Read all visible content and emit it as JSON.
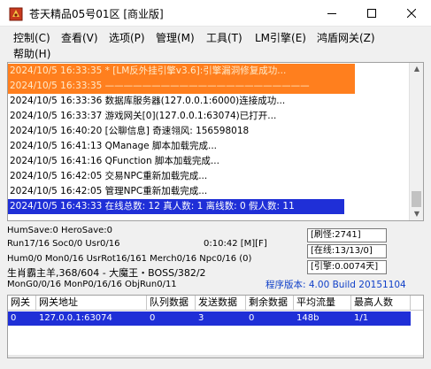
{
  "window": {
    "title": "苍天精品05号01区 [商业版]"
  },
  "menu": [
    "控制(C)",
    "查看(V)",
    "选项(P)",
    "管理(M)",
    "工具(T)",
    "LM引擎(E)",
    "鸿盾网关(Z)",
    "帮助(H)"
  ],
  "log": [
    {
      "text": "2024/10/5 16:33:35 * [LM反外挂引擎v3.6]:引擎漏洞修复成功...",
      "style": "orange"
    },
    {
      "text": "2024/10/5 16:33:35 ——————————————————————",
      "style": "orange"
    },
    {
      "text": "2024/10/5 16:33:36 数据库服务器(127.0.0.1:6000)连接成功...",
      "style": "normal"
    },
    {
      "text": "2024/10/5 16:33:37 游戏网关[0](127.0.0.1:63074)已打开...",
      "style": "normal"
    },
    {
      "text": "2024/10/5 16:40:20 [公聊信息] 奇速翎风: 156598018",
      "style": "normal"
    },
    {
      "text": "2024/10/5 16:41:13 QManage 脚本加载完成...",
      "style": "normal"
    },
    {
      "text": "2024/10/5 16:41:16 QFunction 脚本加载完成...",
      "style": "normal"
    },
    {
      "text": "2024/10/5 16:42:05 交易NPC重新加载完成...",
      "style": "normal"
    },
    {
      "text": "2024/10/5 16:42:05 管理NPC重新加载完成...",
      "style": "normal"
    },
    {
      "text": "2024/10/5 16:43:33 在线总数: 12 真人数: 1 离线数: 0 假人数: 11",
      "style": "selected"
    }
  ],
  "status": {
    "line1": "HumSave:0 HeroSave:0",
    "line2_left": "Run17/16 Soc0/0 Usr0/16",
    "line2_time": "0:10:42 [M][F]",
    "line3": "Hum0/0 Mon0/16 UsrRot16/161 Merch0/16 Npc0/16 (0)",
    "line4": "生肖霸主羊,368/604 - 大魔王・BOSS/382/2",
    "line5": "MonG0/0/16 MonP0/16/16 ObjRun0/11",
    "box1": "[刷怪:2741]",
    "box2": "[在线:13/13/0]",
    "box3": "[引擎:0.0074天]",
    "version": "程序版本: 4.00 Build 20151104"
  },
  "gateway_table": {
    "headers": [
      "网关",
      "网关地址",
      "队列数据",
      "发送数据",
      "剩余数据",
      "平均流量",
      "最高人数"
    ],
    "rows": [
      [
        "0",
        "127.0.0.1:63074",
        "0",
        "3",
        "0",
        "148b",
        "1/1"
      ]
    ]
  }
}
